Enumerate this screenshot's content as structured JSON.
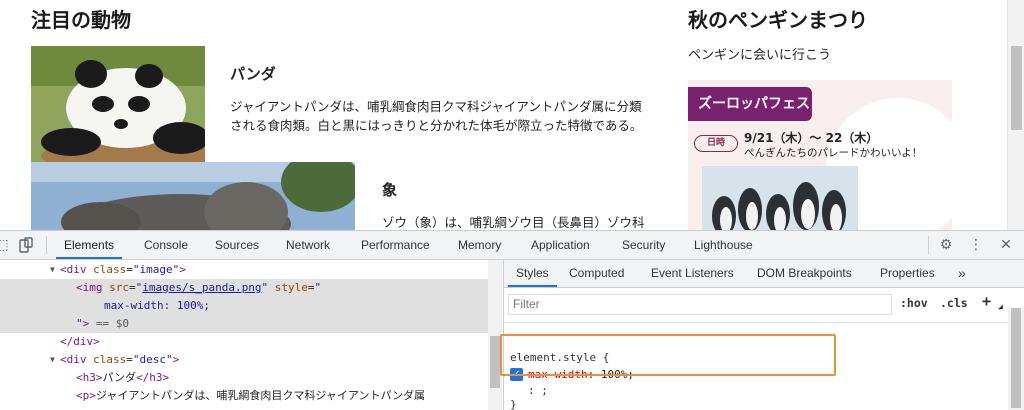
{
  "page": {
    "left_heading": "注目の動物",
    "right_heading": "秋のペンギンまつり",
    "right_sub": "ペンギンに会いに行こう",
    "items": [
      {
        "title": "パンダ",
        "desc_line1": "ジャイアントパンダは、哺乳綱食肉目クマ科ジャイアントパンダ属に分類",
        "desc_line2": "される食肉類。白と黒にはっきりと分かれた体毛が際立った特徴である。"
      },
      {
        "title": "象",
        "desc_line1": "ゾウ（象）は、哺乳綱ゾウ目（長鼻目）ゾウ科"
      }
    ],
    "banner": {
      "tag": "ズーロッパフェス",
      "pill": "日時",
      "date": "9/21（木）〜 22（木）",
      "note": "ぺんぎんたちのパレードかわいいよ！"
    }
  },
  "devtools": {
    "tabs": [
      "Elements",
      "Console",
      "Sources",
      "Network",
      "Performance",
      "Memory",
      "Application",
      "Security",
      "Lighthouse"
    ],
    "active_tab": "Elements",
    "dom": {
      "div_image_class": "image",
      "img_src": "images/s_panda.png",
      "img_style_attr": "style",
      "img_style_value": "max-width: 100%;",
      "selected_marker": "== $0",
      "close_div": "</div>",
      "div_desc_class": "desc",
      "h3_text": "パンダ",
      "p_text": "ジャイアントパンダは、哺乳綱食肉目クマ科ジャイアントパンダ属"
    },
    "styles_tabs": [
      "Styles",
      "Computed",
      "Event Listeners",
      "DOM Breakpoints",
      "Properties"
    ],
    "more_tabs": "»",
    "filter_placeholder": "Filter",
    "hov": ":hov",
    "cls": ".cls",
    "add": "+",
    "rule_selector": "element.style {",
    "rule_prop": "max-width",
    "rule_value": "100%;",
    "rule_new": ": ;",
    "rule_close": "}"
  },
  "colors": {
    "accent": "#1a73e8",
    "banner_tag": "#7b1f6f",
    "highlight_box": "#e8913a"
  }
}
